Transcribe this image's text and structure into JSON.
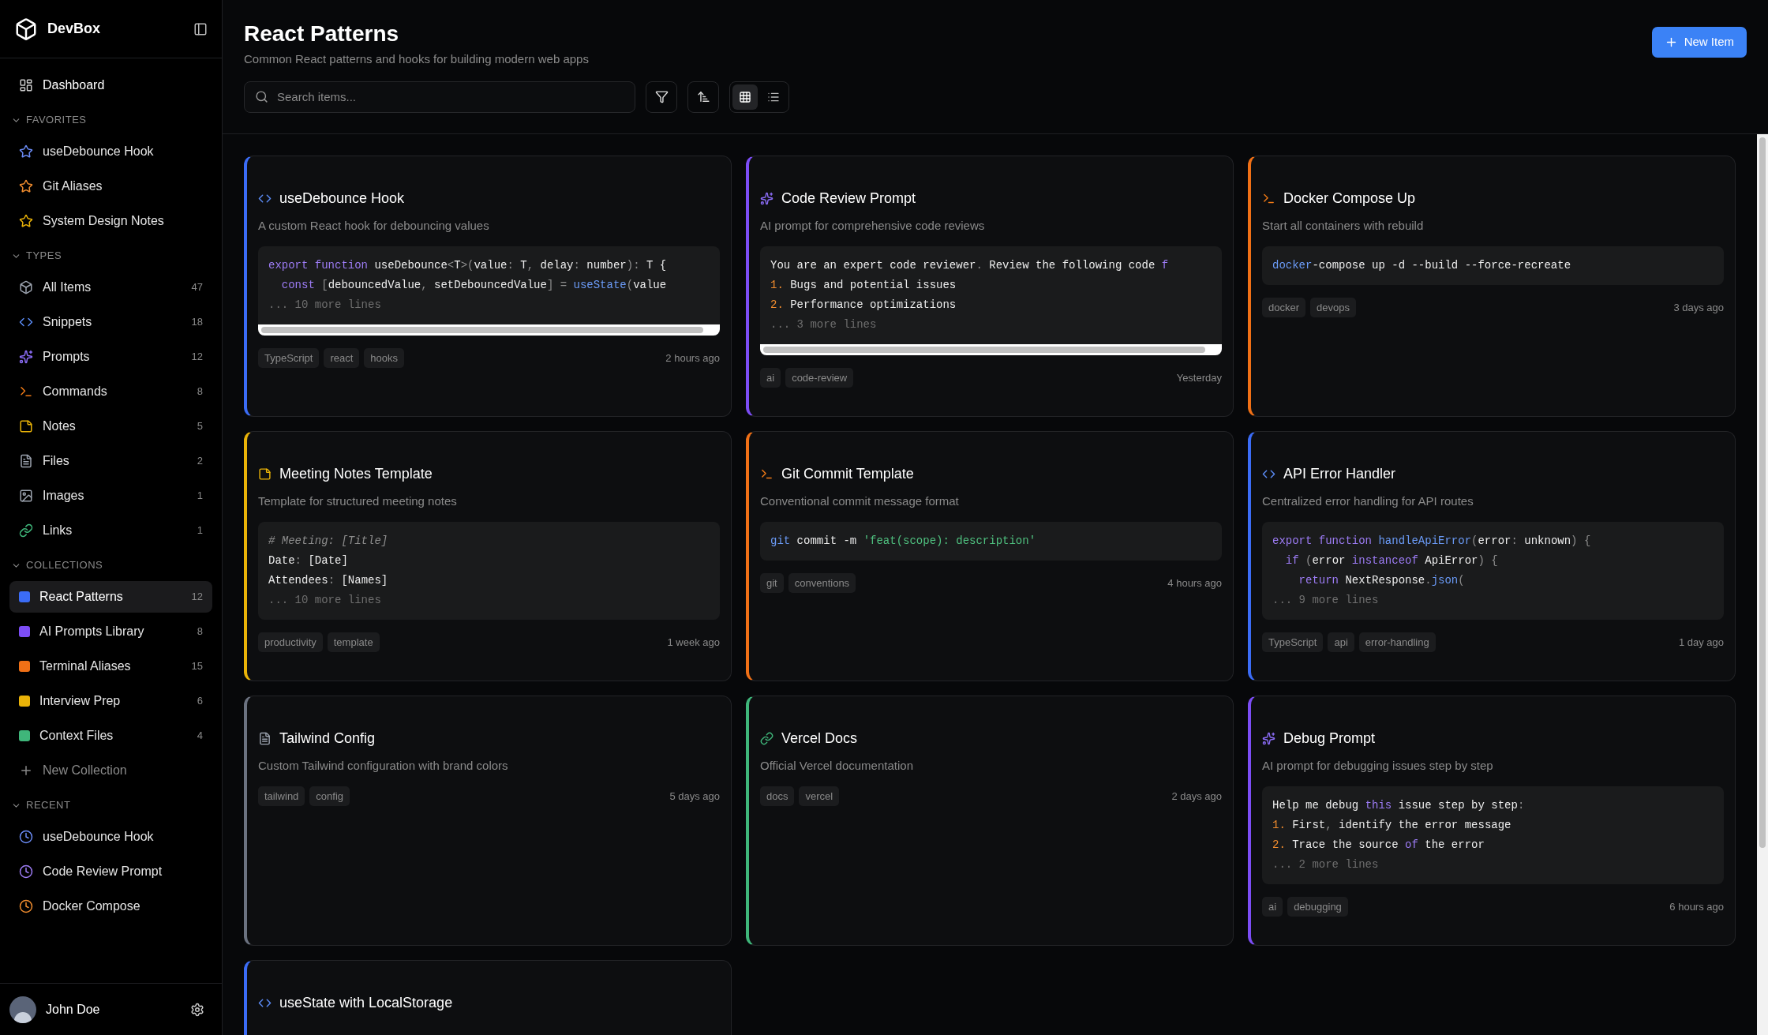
{
  "sidebar": {
    "brand": "DevBox",
    "nav": [
      {
        "label": "Dashboard",
        "selected": false
      }
    ],
    "sections": [
      {
        "kind": "favorites",
        "title": "FAVORITES",
        "expanded": true,
        "items": [
          {
            "label": "useDebounce Hook",
            "color": "#6b8cf7"
          },
          {
            "label": "Git Aliases",
            "color": "#f08c2e"
          },
          {
            "label": "System Design Notes",
            "color": "#eab308"
          }
        ]
      },
      {
        "kind": "types",
        "title": "TYPES",
        "expanded": true,
        "items": [
          {
            "label": "All Items",
            "kind": "all",
            "count": "47"
          },
          {
            "label": "Snippets",
            "kind": "snippet",
            "count": "18"
          },
          {
            "label": "Prompts",
            "kind": "prompt",
            "count": "12"
          },
          {
            "label": "Commands",
            "kind": "command",
            "count": "8"
          },
          {
            "label": "Notes",
            "kind": "note",
            "count": "5"
          },
          {
            "label": "Files",
            "kind": "file",
            "count": "2"
          },
          {
            "label": "Images",
            "kind": "image",
            "count": "1"
          },
          {
            "label": "Links",
            "kind": "link",
            "count": "1"
          }
        ]
      },
      {
        "kind": "collections",
        "title": "COLLECTIONS",
        "expanded": true,
        "items": [
          {
            "label": "React Patterns",
            "color": "#3b6cf6",
            "count": "12",
            "selected": true
          },
          {
            "label": "AI Prompts Library",
            "color": "#7c4df5",
            "count": "8",
            "selected": false
          },
          {
            "label": "Terminal Aliases",
            "color": "#f07016",
            "count": "15",
            "selected": false
          },
          {
            "label": "Interview Prep",
            "color": "#eab308",
            "count": "6",
            "selected": false
          },
          {
            "label": "Context Files",
            "color": "#3fb67a",
            "count": "4",
            "selected": false
          }
        ],
        "add_label": "New Collection"
      },
      {
        "kind": "recent",
        "title": "RECENT",
        "expanded": true,
        "items": [
          {
            "label": "useDebounce Hook",
            "color": "#6b8cf7"
          },
          {
            "label": "Code Review Prompt",
            "color": "#9d7cf5"
          },
          {
            "label": "Docker Compose",
            "color": "#f08c2e"
          }
        ]
      }
    ],
    "user": {
      "name": "John Doe"
    }
  },
  "header": {
    "title": "React Patterns",
    "subtitle": "Common React patterns and hooks for building modern web apps",
    "search": {
      "placeholder": "Search items..."
    },
    "views": [
      {
        "kind": "grid",
        "selected": true
      },
      {
        "kind": "list",
        "selected": false
      }
    ],
    "new_button": "New Item"
  },
  "cards": [
    {
      "kind": "snippet",
      "title": "useDebounce Hook",
      "description": "A custom React hook for debouncing values",
      "code": {
        "scrollbar": true,
        "lines": [
          [
            {
              "text": "export function ",
              "kind": "kw"
            },
            {
              "text": "useDebounce",
              "kind": "plain"
            },
            {
              "text": "<",
              "kind": "punct"
            },
            {
              "text": "T",
              "kind": "plain"
            },
            {
              "text": ">(",
              "kind": "punct"
            },
            {
              "text": "value",
              "kind": "plain"
            },
            {
              "text": ": ",
              "kind": "punct"
            },
            {
              "text": "T",
              "kind": "plain"
            },
            {
              "text": ", ",
              "kind": "punct"
            },
            {
              "text": "delay",
              "kind": "plain"
            },
            {
              "text": ": ",
              "kind": "punct"
            },
            {
              "text": "number",
              "kind": "plain"
            },
            {
              "text": "): ",
              "kind": "punct"
            },
            {
              "text": "T {",
              "kind": "plain"
            }
          ],
          [
            {
              "text": "  const ",
              "kind": "kw"
            },
            {
              "text": "[",
              "kind": "punct"
            },
            {
              "text": "debouncedValue",
              "kind": "plain"
            },
            {
              "text": ", ",
              "kind": "punct"
            },
            {
              "text": "setDebouncedValue",
              "kind": "plain"
            },
            {
              "text": "] = ",
              "kind": "punct"
            },
            {
              "text": "useState",
              "kind": "fn"
            },
            {
              "text": "(",
              "kind": "punct"
            },
            {
              "text": "value",
              "kind": "plain"
            }
          ]
        ],
        "more": "... 10 more lines"
      },
      "tags": [
        "TypeScript",
        "react",
        "hooks"
      ],
      "time": "2 hours ago"
    },
    {
      "kind": "prompt",
      "title": "Code Review Prompt",
      "description": "AI prompt for comprehensive code reviews",
      "code": {
        "scrollbar": true,
        "lines": [
          [
            {
              "text": "You are an expert code reviewer",
              "kind": "plain"
            },
            {
              "text": ".",
              "kind": "punct"
            },
            {
              "text": " Review the following code ",
              "kind": "plain"
            },
            {
              "text": "f",
              "kind": "kw"
            }
          ],
          [
            {
              "text": "1. ",
              "kind": "num"
            },
            {
              "text": "Bugs and potential issues",
              "kind": "plain"
            }
          ],
          [
            {
              "text": "2. ",
              "kind": "num"
            },
            {
              "text": "Performance optimizations",
              "kind": "plain"
            }
          ]
        ],
        "more": "... 3 more lines"
      },
      "tags": [
        "ai",
        "code-review"
      ],
      "time": "Yesterday"
    },
    {
      "kind": "command",
      "title": "Docker Compose Up",
      "description": "Start all containers with rebuild",
      "code": {
        "scrollbar": false,
        "lines": [
          [
            {
              "text": "docker",
              "kind": "fn"
            },
            {
              "text": "-compose up -d --build --force-recreate",
              "kind": "plain"
            }
          ]
        ]
      },
      "tags": [
        "docker",
        "devops"
      ],
      "time": "3 days ago"
    },
    {
      "kind": "note",
      "title": "Meeting Notes Template",
      "description": "Template for structured meeting notes",
      "code": {
        "scrollbar": false,
        "lines": [
          [
            {
              "text": "# Meeting: [Title]",
              "kind": "comment"
            }
          ],
          [
            {
              "text": "Date",
              "kind": "plain"
            },
            {
              "text": ": ",
              "kind": "punct"
            },
            {
              "text": "[Date]",
              "kind": "plain"
            }
          ],
          [
            {
              "text": "Attendees",
              "kind": "plain"
            },
            {
              "text": ": ",
              "kind": "punct"
            },
            {
              "text": "[Names]",
              "kind": "plain"
            }
          ]
        ],
        "more": "... 10 more lines"
      },
      "tags": [
        "productivity",
        "template"
      ],
      "time": "1 week ago"
    },
    {
      "kind": "command",
      "title": "Git Commit Template",
      "description": "Conventional commit message format",
      "code": {
        "scrollbar": false,
        "lines": [
          [
            {
              "text": "git",
              "kind": "fn"
            },
            {
              "text": " commit -m ",
              "kind": "plain"
            },
            {
              "text": "'feat(scope): description'",
              "kind": "str"
            }
          ]
        ]
      },
      "tags": [
        "git",
        "conventions"
      ],
      "time": "4 hours ago"
    },
    {
      "kind": "snippet",
      "title": "API Error Handler",
      "description": "Centralized error handling for API routes",
      "code": {
        "scrollbar": false,
        "lines": [
          [
            {
              "text": "export function ",
              "kind": "kw"
            },
            {
              "text": "handleApiError",
              "kind": "fn"
            },
            {
              "text": "(",
              "kind": "punct"
            },
            {
              "text": "error",
              "kind": "plain"
            },
            {
              "text": ": ",
              "kind": "punct"
            },
            {
              "text": "unknown",
              "kind": "plain"
            },
            {
              "text": ") {",
              "kind": "punct"
            }
          ],
          [
            {
              "text": "  if ",
              "kind": "kw"
            },
            {
              "text": "(",
              "kind": "punct"
            },
            {
              "text": "error ",
              "kind": "plain"
            },
            {
              "text": "instanceof ",
              "kind": "kw"
            },
            {
              "text": "ApiError",
              "kind": "plain"
            },
            {
              "text": ") {",
              "kind": "punct"
            }
          ],
          [
            {
              "text": "    return ",
              "kind": "kw"
            },
            {
              "text": "NextResponse",
              "kind": "plain"
            },
            {
              "text": ".",
              "kind": "punct"
            },
            {
              "text": "json",
              "kind": "fn"
            },
            {
              "text": "(",
              "kind": "punct"
            }
          ]
        ],
        "more": "... 9 more lines"
      },
      "tags": [
        "TypeScript",
        "api",
        "error-handling"
      ],
      "time": "1 day ago"
    },
    {
      "kind": "file",
      "title": "Tailwind Config",
      "description": "Custom Tailwind configuration with brand colors",
      "tags": [
        "tailwind",
        "config"
      ],
      "time": "5 days ago"
    },
    {
      "kind": "link",
      "title": "Vercel Docs",
      "description": "Official Vercel documentation",
      "tags": [
        "docs",
        "vercel"
      ],
      "time": "2 days ago"
    },
    {
      "kind": "prompt",
      "title": "Debug Prompt",
      "description": "AI prompt for debugging issues step by step",
      "code": {
        "scrollbar": false,
        "lines": [
          [
            {
              "text": "Help me debug ",
              "kind": "plain"
            },
            {
              "text": "this",
              "kind": "kw"
            },
            {
              "text": " issue step by step",
              "kind": "plain"
            },
            {
              "text": ":",
              "kind": "punct"
            }
          ],
          [
            {
              "text": "1. ",
              "kind": "num"
            },
            {
              "text": "First",
              "kind": "plain"
            },
            {
              "text": ", ",
              "kind": "punct"
            },
            {
              "text": "identify the error message",
              "kind": "plain"
            }
          ],
          [
            {
              "text": "2. ",
              "kind": "num"
            },
            {
              "text": "Trace the source ",
              "kind": "plain"
            },
            {
              "text": "of",
              "kind": "kw"
            },
            {
              "text": " the error",
              "kind": "plain"
            }
          ]
        ],
        "more": "... 2 more lines"
      },
      "tags": [
        "ai",
        "debugging"
      ],
      "time": "6 hours ago"
    },
    {
      "kind": "snippet",
      "title": "useState with LocalStorage"
    }
  ]
}
